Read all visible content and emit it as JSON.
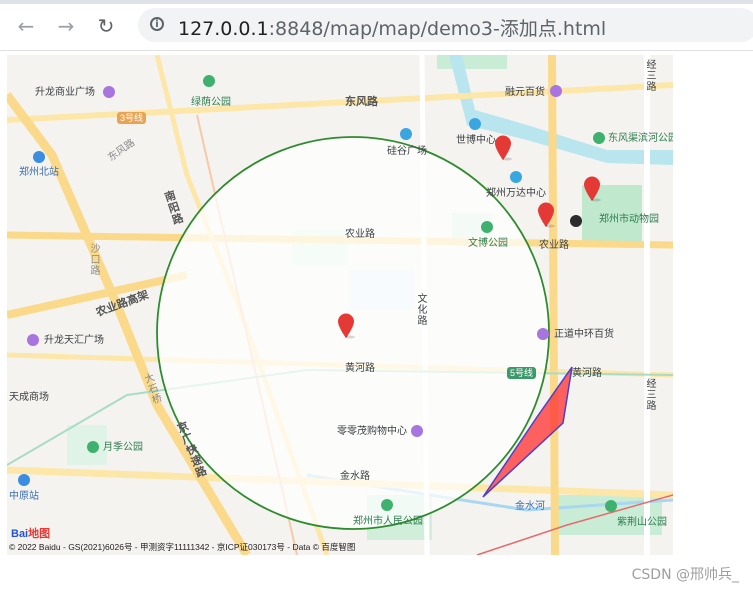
{
  "browser": {
    "url_host": "127.0.0.1",
    "url_path": ":8848/map/map/demo3-添加点.html",
    "back_icon": "arrow-left-icon",
    "forward_icon": "arrow-right-icon",
    "reload_icon": "reload-icon",
    "info_icon": "info-icon"
  },
  "map": {
    "roads": {
      "dongfeng": "东风路",
      "nongye_main": "农业路",
      "nongye_east": "农业路",
      "nongye_elevated": "农业路高架",
      "huanghe": "黄河路",
      "huanghe_east": "黄河路",
      "jinshui": "金水路",
      "nanyang": "南阳路",
      "wenhua": "文化路",
      "dongfeng_nw": "东风路",
      "jingsan_top": "经三路",
      "jingsan_bottom": "经三路",
      "jingguang": "京广快速路",
      "shakou": "沙口路",
      "jinshui_river": "金水河",
      "dashi": "大石桥"
    },
    "pois": {
      "shengda": "升龙商业广场",
      "lvyin": "绿荫公园",
      "zhengzhou_north": "郑州北站",
      "guigu": "硅谷广场",
      "shibo": "世博中心",
      "wanda": "郑州万达中心",
      "rongyuan": "融元百货",
      "dongfeng_park": "东风渠滨河公园",
      "zoo": "郑州市动物园",
      "wenbo": "文博公园",
      "zhengdao": "正道中环百货",
      "shengtianhui": "升龙天汇广场",
      "tiancheng": "天成商场",
      "yueji": "月季公园",
      "zhongyuan": "中原站",
      "lingling": "零零茂购物中心",
      "renmin": "郑州市人民公园",
      "zijingshan": "紫荆山公园"
    },
    "badges": {
      "line3": "3号线",
      "line5": "5号线"
    },
    "copyright": "© 2022 Baidu - GS(2021)6026号 - 甲测资字11111342 - 京ICP证030173号 - Data © 百度智图",
    "logo": "Bai",
    "logo_suffix": "地图"
  },
  "colors": {
    "circle_stroke": "#2e8b2e",
    "polygon_fill": "#ff3030",
    "polygon_stroke": "#4a3fd1",
    "marker": "#e53935"
  },
  "watermark": "CSDN @邢帅兵_"
}
